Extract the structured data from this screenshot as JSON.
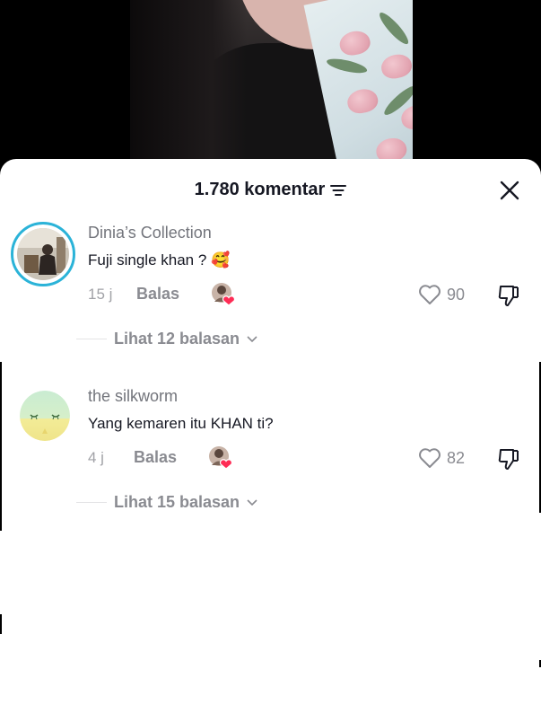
{
  "comments_sheet": {
    "count_title": "1.780 komentar",
    "filter_icon": "sort-filter-icon",
    "close_icon": "close-icon"
  },
  "comments": [
    {
      "author": "Dinia’s Collection",
      "text": "Fuji single khan ?",
      "emoji": "🥰",
      "time": "15 j",
      "reply_label": "Balas",
      "likes": "90",
      "view_replies": "Lihat 12 balasan"
    },
    {
      "author": "the silkworm",
      "text": "Yang kemaren itu KHAN ti?",
      "time": "4 j",
      "reply_label": "Balas",
      "likes": "82",
      "view_replies": "Lihat 15 balasan"
    }
  ],
  "colors": {
    "story_ring": "#2bb3d8",
    "text_primary": "#161823",
    "text_secondary": "#8a8b91",
    "heart_red": "#fe2c55"
  }
}
